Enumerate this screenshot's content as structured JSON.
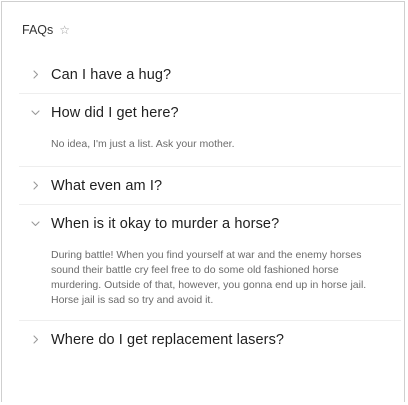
{
  "header": {
    "title": "FAQs",
    "star_glyph": "☆"
  },
  "icons": {
    "collapsed": "chevron-right-icon",
    "expanded": "chevron-down-icon",
    "favorite": "star-outline-icon"
  },
  "colors": {
    "question_text": "#1f1f1f",
    "answer_text": "#6b6b6b",
    "chevron": "#9a9a9a",
    "divider": "#eeeeee"
  },
  "faqs": [
    {
      "question": "Can I have a hug?",
      "expanded": false,
      "answer": ""
    },
    {
      "question": "How did I get here?",
      "expanded": true,
      "answer": "No idea, I'm just a list. Ask your mother."
    },
    {
      "question": "What even am I?",
      "expanded": false,
      "answer": ""
    },
    {
      "question": "When is it okay to murder a horse?",
      "expanded": true,
      "answer": "During battle! When you find yourself at war and the enemy horses sound their battle cry feel free to do some old fashioned horse murdering. Outside of that, however, you gonna end up in horse jail. Horse jail is sad so try and avoid it."
    },
    {
      "question": "Where do I get replacement lasers?",
      "expanded": false,
      "answer": ""
    }
  ]
}
